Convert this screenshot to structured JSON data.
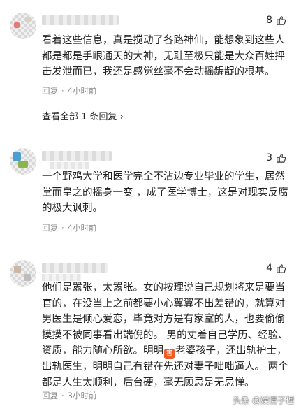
{
  "comments": [
    {
      "likes": "8",
      "text": "看着这些信息，真是搅动了各路神仙，能想象到这些人都是都是手眼通天的大神，无耻至极只能是大众百姓抨击发泄而已，我还是感觉丝毫不会动摇龌龊的根基。",
      "reply_label": "回复",
      "time": "4小时前",
      "view_all": "查看全部 1 条回复",
      "view_all_arrow": "›"
    },
    {
      "likes": "3",
      "text": "一个野鸡大学和医学完全不沾边专业毕业的学生，居然堂而皇之的摇身一变 ，成了医学博士，这是对现实反腐的极大讽刺。",
      "reply_label": "回复",
      "time": "4小时前"
    },
    {
      "likes": "4",
      "text_a": "他们是嚣张，太嚣张。女的按理说自己规划将来是要当官的，在没当上之前都要小心翼翼不出差错的，就算对男医生是倾心爱恋，毕竟对方是有家室的人，也要偷偷摸摸不被同事看出端倪的。 男的丈着自己学历、经验、资质，能力随心所欲。明明",
      "emoji_label": "害",
      "text_b": "老婆孩子，还出轨护士，出轨医生，明明自己有错在先还对妻子咄咄逼人。 两个都是人生太顺利，后台硬，毫无顾忌是无忌惮。",
      "reply_label": "回复",
      "time": "3小时前"
    }
  ],
  "watermark": "头条 @娱情子理",
  "colors": {
    "text": "#222222",
    "meta": "#8a8a8a",
    "emoji": "#f05a24"
  },
  "icons": {
    "like": "thumbs-up-icon"
  }
}
